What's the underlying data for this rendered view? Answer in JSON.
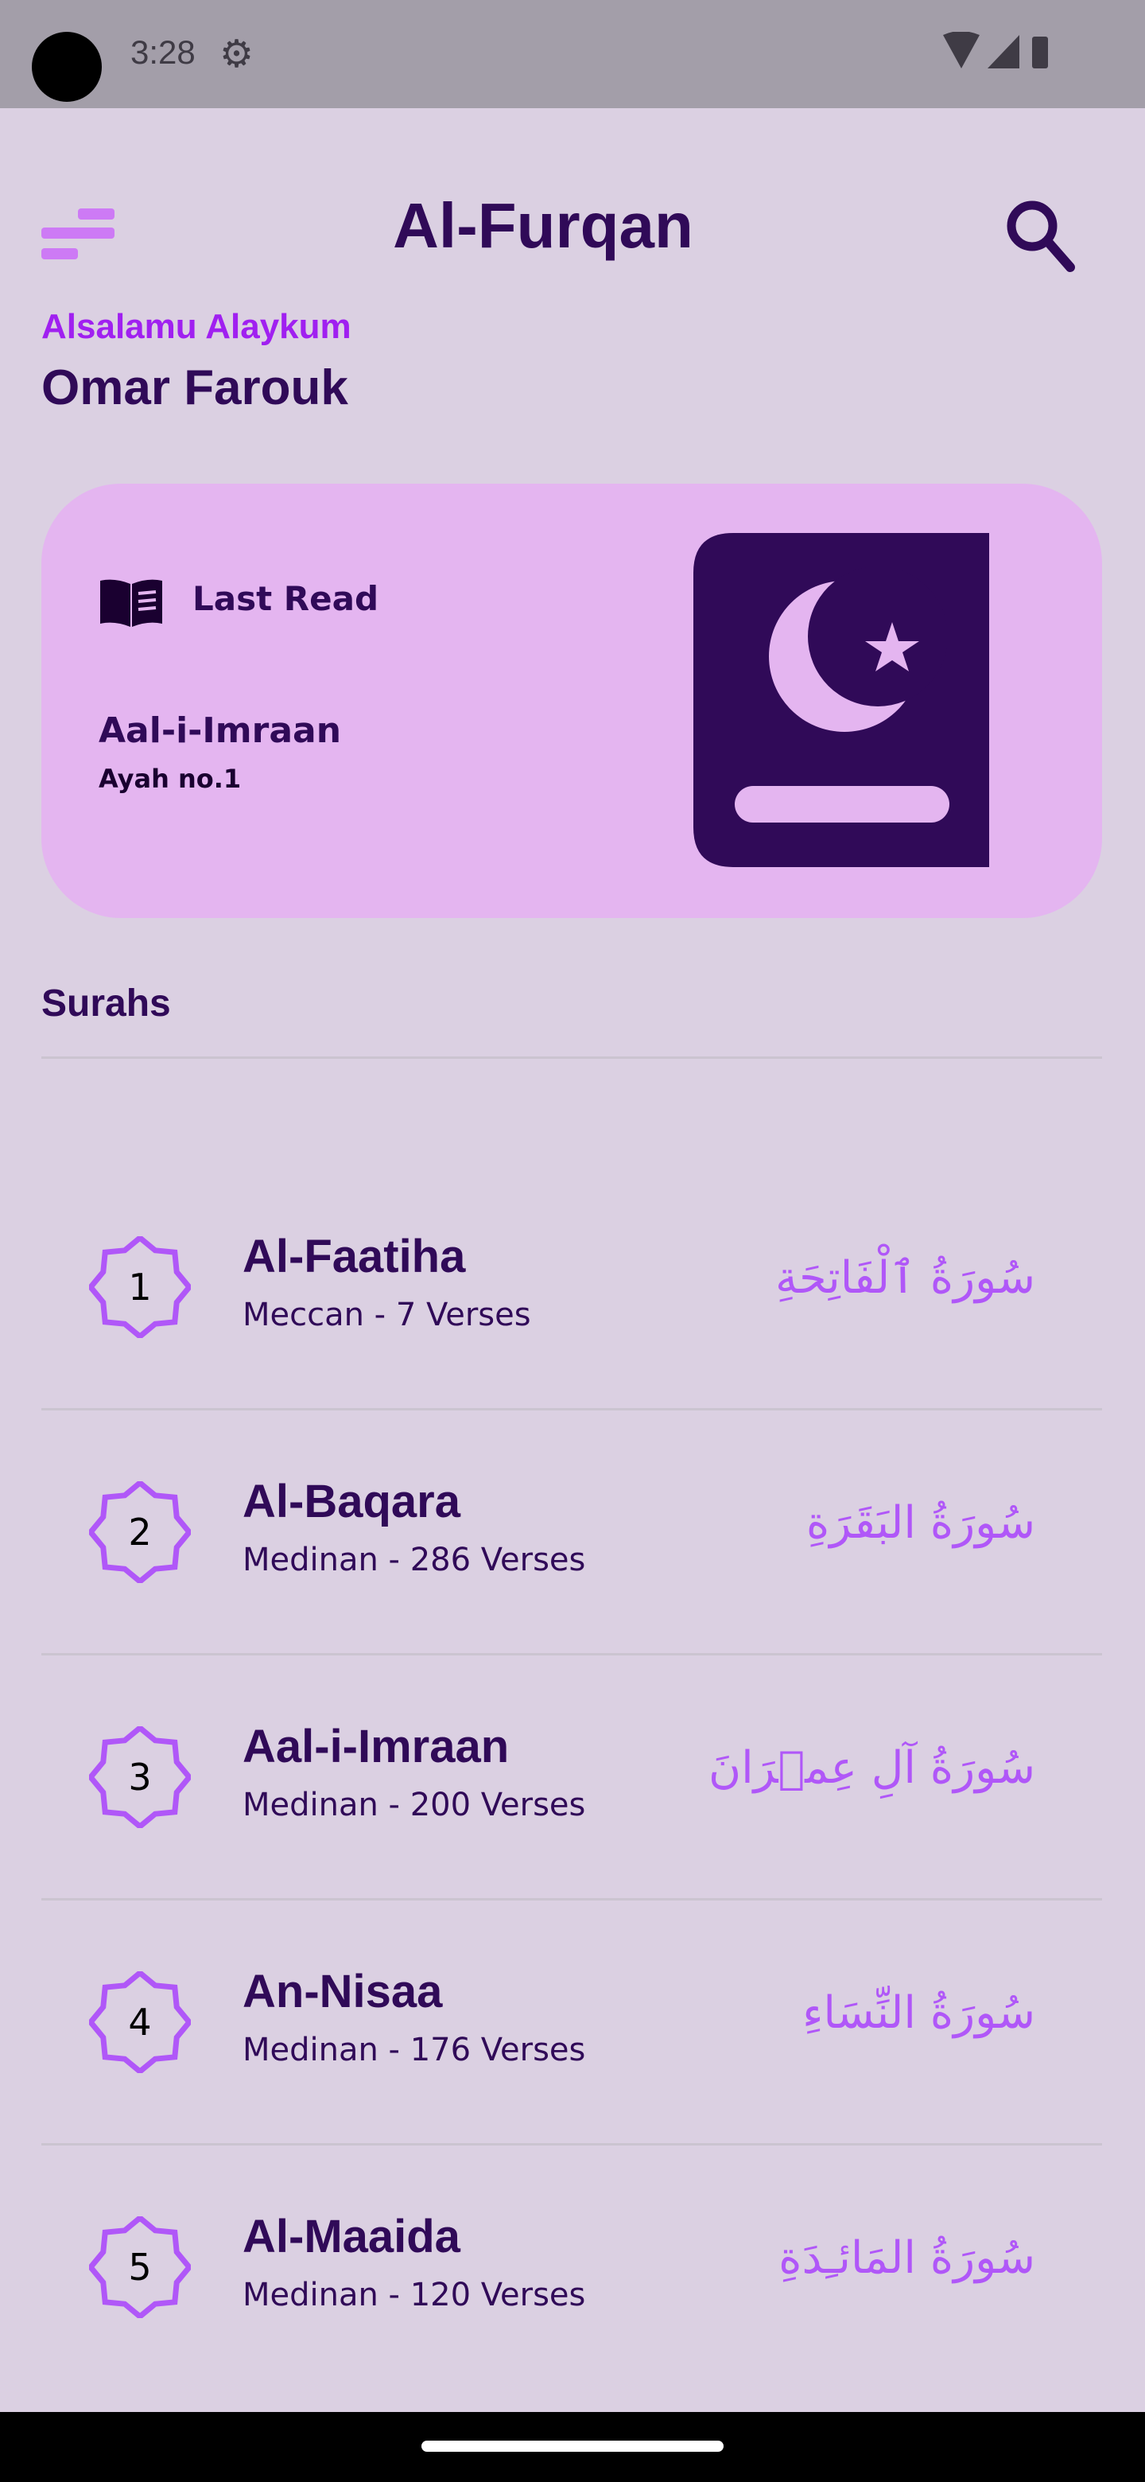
{
  "status": {
    "time": "3:28"
  },
  "header": {
    "title": "Al-Furqan"
  },
  "greeting": {
    "salutation": "Alsalamu Alaykum",
    "user_name": "Omar Farouk"
  },
  "last_read": {
    "label": "Last Read",
    "surah": "Aal-i-Imraan",
    "ayah": "Ayah no.1"
  },
  "section_title": "Surahs",
  "colors": {
    "background": "#dbd0e2",
    "primary_dark": "#300a58",
    "accent": "#a020f0",
    "card": "#e4b5f0",
    "arabic": "#b057f8"
  },
  "surahs": [
    {
      "number": "1",
      "name": "Al-Faatiha",
      "info": "Meccan - 7 Verses",
      "arabic": "سُورَةُ ٱلْفَاتِحَةِ"
    },
    {
      "number": "2",
      "name": "Al-Baqara",
      "info": "Medinan - 286 Verses",
      "arabic": "سُورَةُ البَقَرَةِ"
    },
    {
      "number": "3",
      "name": "Aal-i-Imraan",
      "info": "Medinan - 200 Verses",
      "arabic": "سُورَةُ آلِ عِمۡرَانَ"
    },
    {
      "number": "4",
      "name": "An-Nisaa",
      "info": "Medinan - 176 Verses",
      "arabic": "سُورَةُ النِّسَاءِ"
    },
    {
      "number": "5",
      "name": "Al-Maaida",
      "info": "Medinan - 120 Verses",
      "arabic": "سُورَةُ المَائـِدَةِ"
    }
  ]
}
